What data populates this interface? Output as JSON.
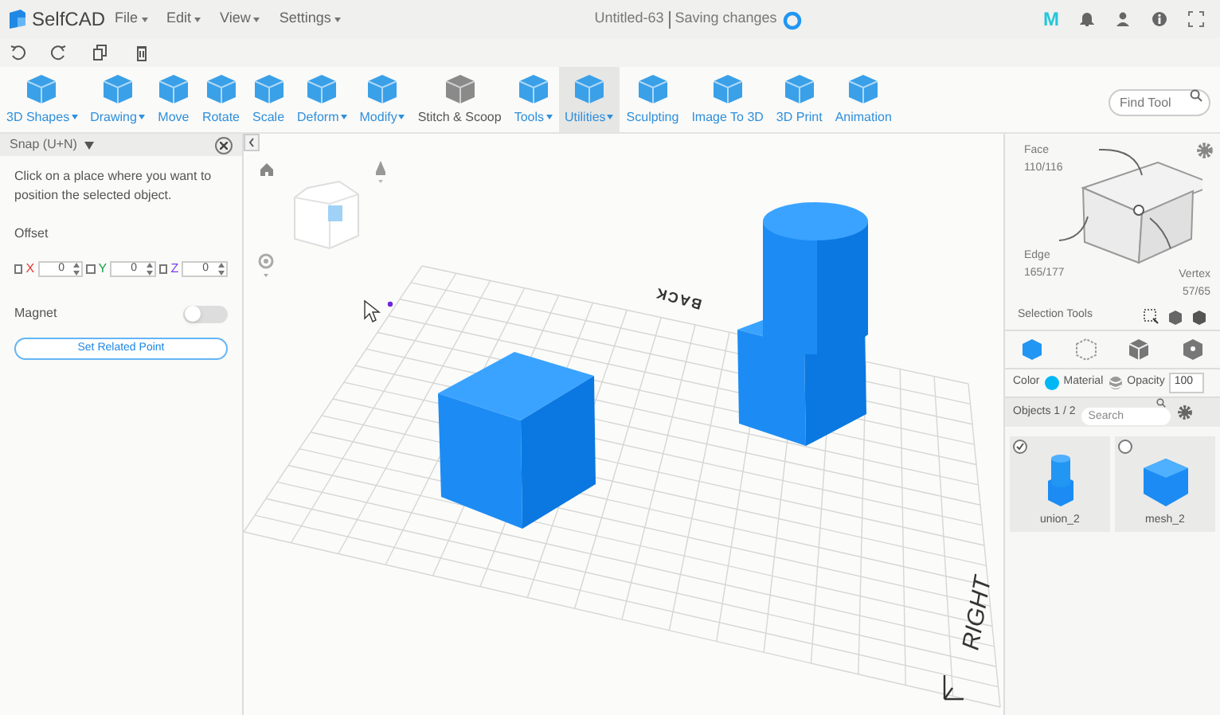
{
  "app": {
    "name": "SelfCAD",
    "menus": [
      {
        "label": "File"
      },
      {
        "label": "Edit"
      },
      {
        "label": "View"
      },
      {
        "label": "Settings"
      }
    ],
    "document_title": "Untitled-63",
    "save_status": "Saving changes",
    "m_badge": "M"
  },
  "toolbar": {
    "tools": [
      {
        "label": "3D Shapes",
        "has_menu": true,
        "selected": false
      },
      {
        "label": "Drawing",
        "has_menu": true,
        "selected": false
      },
      {
        "label": "Move",
        "has_menu": false,
        "selected": false
      },
      {
        "label": "Rotate",
        "has_menu": false,
        "selected": false
      },
      {
        "label": "Scale",
        "has_menu": false,
        "selected": false
      },
      {
        "label": "Deform",
        "has_menu": true,
        "selected": false
      },
      {
        "label": "Modify",
        "has_menu": true,
        "selected": false
      },
      {
        "label": "Stitch & Scoop",
        "has_menu": false,
        "selected": false
      },
      {
        "label": "Tools",
        "has_menu": true,
        "selected": false
      },
      {
        "label": "Utilities",
        "has_menu": true,
        "selected": true
      },
      {
        "label": "Sculpting",
        "has_menu": false,
        "selected": false
      },
      {
        "label": "Image To 3D",
        "has_menu": false,
        "selected": false
      },
      {
        "label": "3D Print",
        "has_menu": false,
        "selected": false
      },
      {
        "label": "Animation",
        "has_menu": false,
        "selected": false
      }
    ],
    "find_tool": {
      "placeholder": "Find Tool"
    }
  },
  "snap_panel": {
    "title": "Snap (U+N)",
    "instructions": "Click on a place where you want to position the selected object.",
    "offset_label": "Offset",
    "axes": [
      {
        "label": "X",
        "checked": false,
        "value": "0",
        "color": "#e53935"
      },
      {
        "label": "Y",
        "checked": false,
        "value": "0",
        "color": "#16a34a"
      },
      {
        "label": "Z",
        "checked": false,
        "value": "0",
        "color": "#7c3aed"
      }
    ],
    "magnet": {
      "label": "Magnet",
      "on": false
    },
    "button": "Set Related Point"
  },
  "viewport": {
    "labels": [
      {
        "kind": "back",
        "text": "BACK"
      },
      {
        "kind": "right",
        "text": "RIGHT"
      }
    ]
  },
  "right_panel": {
    "selection_modes": [
      {
        "label": "Face",
        "count": "110/116"
      },
      {
        "label": "Edge",
        "count": "165/177"
      },
      {
        "label": "Vertex",
        "count": "57/65"
      }
    ],
    "selection_tools_label": "Selection Tools",
    "mode_tabs": [
      {
        "selected": true
      },
      {
        "selected": false
      },
      {
        "selected": false
      },
      {
        "selected": false
      }
    ],
    "color_label": "Color",
    "color": "#00b7f5",
    "material_label": "Material",
    "opacity_label": "Opacity",
    "opacity": "100",
    "objects_label": "Objects 1 / 2",
    "search": {
      "placeholder": "Search"
    },
    "objects": [
      {
        "name": "union_2",
        "kind": "union",
        "checked": true
      },
      {
        "name": "mesh_2",
        "kind": "cube",
        "checked": false
      }
    ]
  }
}
